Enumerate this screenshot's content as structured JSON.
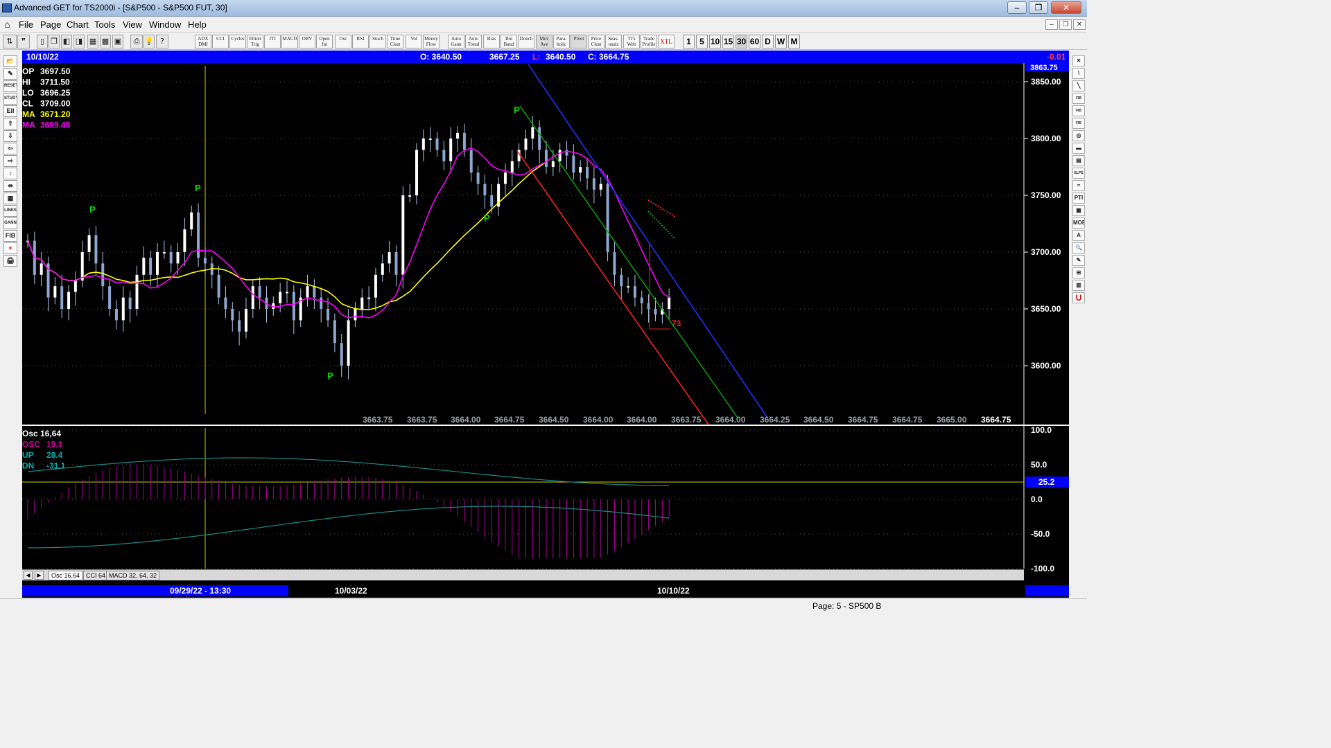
{
  "window": {
    "title": "Advanced GET for TS2000i - [S&P500 - S&P500 FUT, 30]",
    "min": "–",
    "max": "❐",
    "close": "✕"
  },
  "menu": [
    "File",
    "Page",
    "Chart",
    "Tools",
    "View",
    "Window",
    "Help"
  ],
  "mdi_controls": [
    "–",
    "❐",
    "✕"
  ],
  "toolbar": {
    "buttons": [
      {
        "label": "ADX\nDMI"
      },
      {
        "label": "CCI"
      },
      {
        "label": "Cycles"
      },
      {
        "label": "Elliott\nTrig"
      },
      {
        "label": "JTI"
      },
      {
        "label": "MACD"
      },
      {
        "label": "OBV"
      },
      {
        "label": "Open\nInt"
      },
      {
        "label": "Osc"
      },
      {
        "label": "RSI"
      },
      {
        "label": "Stoch"
      },
      {
        "label": "Time\nClust"
      },
      {
        "label": "Vol"
      },
      {
        "label": "Money\nFlow"
      },
      {
        "label": "Auto\nGann"
      },
      {
        "label": "Auto\nTrend"
      },
      {
        "label": "Bias"
      },
      {
        "label": "Bol\nBand"
      },
      {
        "label": "Donch"
      },
      {
        "label": "Mov\nAve"
      },
      {
        "label": "Para-\nbolic"
      },
      {
        "label": "Pivot"
      },
      {
        "label": "Price\nClust"
      },
      {
        "label": "Seas-\nonals"
      },
      {
        "label": "TJ's\nWeb"
      },
      {
        "label": "Trade\nProfile"
      },
      {
        "label": "XTL"
      }
    ],
    "timeframes": [
      "1",
      "5",
      "10",
      "15",
      "30",
      "60",
      "D",
      "W",
      "M"
    ]
  },
  "info_bar": {
    "date": "10/10/22",
    "open": "O: 3640.50",
    "high": "3667.25",
    "low_prefix": "L:",
    "low": "3640.50",
    "close": "C: 3664.75",
    "change": "-0.01"
  },
  "price_panel": {
    "readouts": [
      {
        "label": "OP",
        "value": "3697.50",
        "color": "#ffffff"
      },
      {
        "label": "HI",
        "value": "3711.50",
        "color": "#ffffff"
      },
      {
        "label": "LO",
        "value": "3696.25",
        "color": "#ffffff"
      },
      {
        "label": "CL",
        "value": "3709.00",
        "color": "#ffffff"
      },
      {
        "label": "MA",
        "value": "3671.20",
        "color": "#ffff00"
      },
      {
        "label": "MA",
        "value": "3699.45",
        "color": "#ff00ff"
      }
    ],
    "y_ticks": [
      "3850.00",
      "3800.00",
      "3750.00",
      "3700.00",
      "3650.00",
      "3600.00"
    ],
    "top_tag": "3863.75",
    "bottom_values": [
      "3663.75",
      "3663.75",
      "3664.00",
      "3664.75",
      "3664.50",
      "3664.00",
      "3664.00",
      "3663.75",
      "3664.00",
      "3664.25",
      "3664.50",
      "3664.75",
      "3664.75",
      "3665.00",
      "3664.75"
    ],
    "pivot_label": "P",
    "count_label": "73"
  },
  "osc_panel": {
    "readouts": [
      {
        "label": "Osc 16,64",
        "value": "",
        "color": "#ffffff"
      },
      {
        "label": "OSC",
        "value": "19.1",
        "color": "#cc0099"
      },
      {
        "label": "UP",
        "value": "28.4",
        "color": "#00b0b0"
      },
      {
        "label": "DN",
        "value": "-31.1",
        "color": "#00b0b0"
      }
    ],
    "y_ticks": [
      "100.0",
      "50.0",
      "0.0",
      "-50.0",
      "-100.0"
    ],
    "level_tag": "25.2"
  },
  "tabs": [
    "Osc 16,64",
    "CCI 64",
    "MACD 32, 64, 32"
  ],
  "tab_nav": [
    "◀",
    "▶"
  ],
  "dates": [
    "09/29/22 - 13:30",
    "10/03/22",
    "10/10/22"
  ],
  "status": "Page: 5 - SP500 B",
  "left_tools": [
    "📂",
    "✎",
    "RESET",
    "STUDY",
    "Ell",
    "⇧",
    "⇩",
    "⇦",
    "⇨",
    "↕",
    "⇹",
    "▦",
    "LINES",
    "GANN",
    "FIB",
    "+",
    "🖨"
  ],
  "right_tools": [
    "✕",
    "\\",
    "╲",
    "FIB RET",
    "FIB EXT",
    "FIB TIME",
    "◎",
    "▬",
    "▤",
    "ELPS",
    "≈",
    "PTI",
    "▦",
    "MOB",
    "A",
    "🔍",
    "✎",
    "⊞",
    "▥",
    "U"
  ],
  "colors": {
    "accent_blue": "#0000ff",
    "ma_yellow": "#ffff00",
    "ma_magenta": "#ff00ff",
    "candle": "#b8c8e8",
    "pivot_green": "#00dd00"
  }
}
